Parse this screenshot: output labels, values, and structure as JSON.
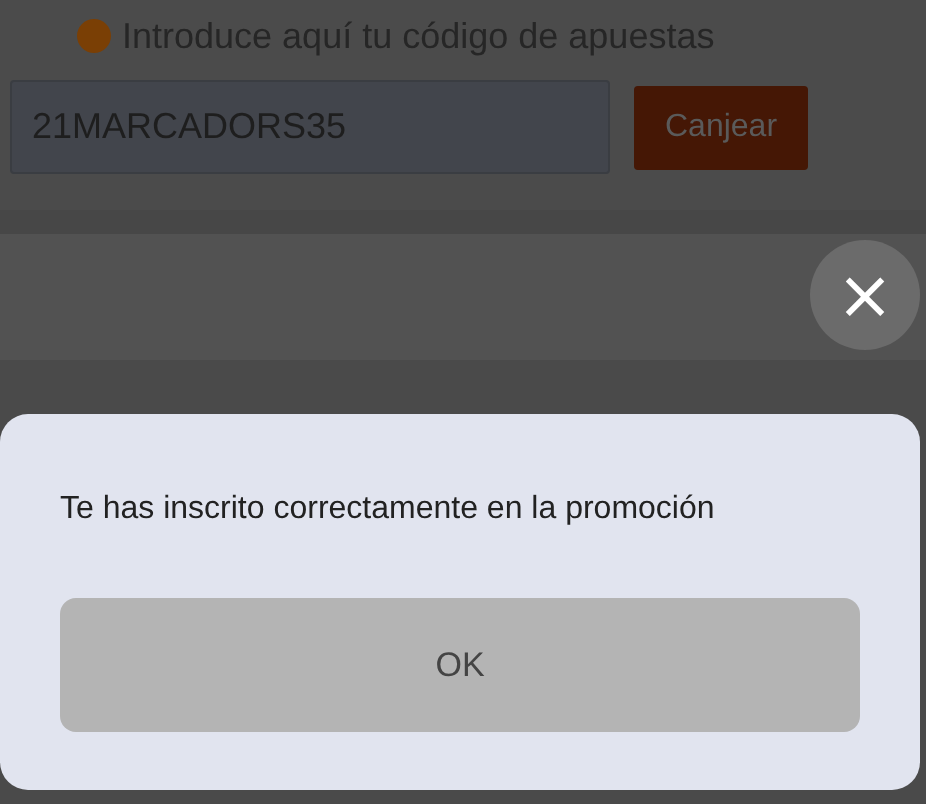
{
  "promo_code": {
    "label": "Introduce aquí tu código de apuestas",
    "value": "21MARCADORS35",
    "redeem_button": "Canjear"
  },
  "close_button": {
    "label": "×"
  },
  "dialog": {
    "message": "Te has inscrito correctamente en la promoción",
    "button": "OK"
  }
}
